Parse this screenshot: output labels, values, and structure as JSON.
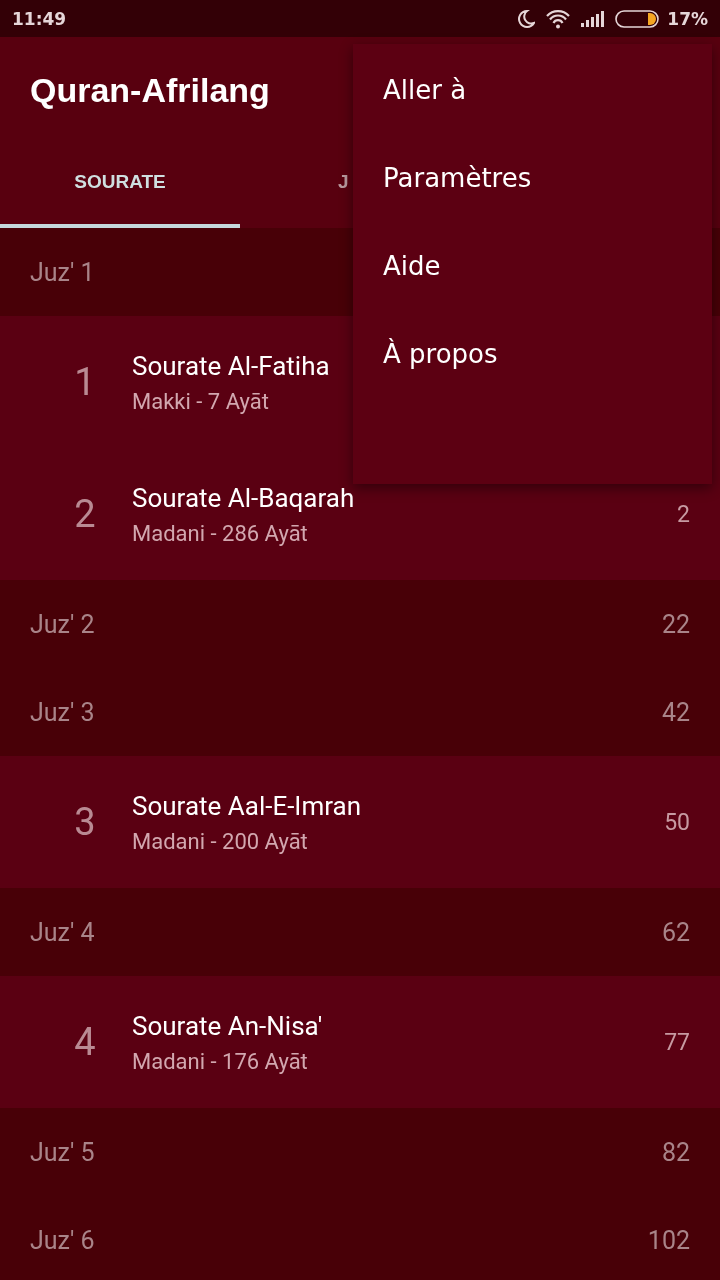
{
  "status_bar": {
    "time": "11:49",
    "battery": "17%"
  },
  "app_bar": {
    "title": "Quran-Afrilang"
  },
  "tabs": [
    {
      "label": "SOURATE",
      "selected": true
    },
    {
      "label": "J",
      "selected": false
    }
  ],
  "list": [
    {
      "kind": "juz",
      "label": "Juz' 1"
    },
    {
      "kind": "surah",
      "number": "1",
      "title": "Sourate Al-Fatiha",
      "subtitle": "Makki - 7 Ayāt"
    },
    {
      "kind": "surah",
      "number": "2",
      "title": "Sourate Al-Baqarah",
      "subtitle": "Madani - 286 Ayāt",
      "page": "2"
    },
    {
      "kind": "juz",
      "label": "Juz' 2",
      "page": "22"
    },
    {
      "kind": "juz",
      "label": "Juz' 3",
      "page": "42"
    },
    {
      "kind": "surah",
      "number": "3",
      "title": "Sourate Aal-E-Imran",
      "subtitle": "Madani - 200 Ayāt",
      "page": "50"
    },
    {
      "kind": "juz",
      "label": "Juz' 4",
      "page": "62"
    },
    {
      "kind": "surah",
      "number": "4",
      "title": "Sourate An-Nisa'",
      "subtitle": "Madani - 176 Ayāt",
      "page": "77"
    },
    {
      "kind": "juz",
      "label": "Juz' 5",
      "page": "82"
    },
    {
      "kind": "juz",
      "label": "Juz' 6",
      "page": "102"
    }
  ],
  "menu": {
    "items": [
      "Aller à",
      "Paramètres",
      "Aide",
      "À propos"
    ]
  }
}
